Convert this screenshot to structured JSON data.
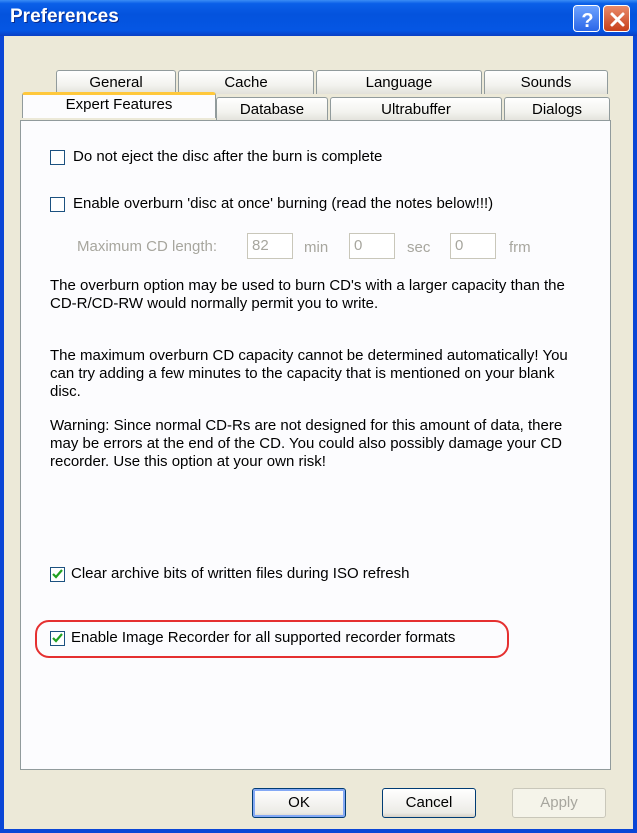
{
  "window": {
    "title": "Preferences"
  },
  "tabs": {
    "row_back": [
      "General",
      "Cache",
      "Language",
      "Sounds"
    ],
    "row_front": [
      "Expert Features",
      "Database",
      "Ultrabuffer",
      "Dialogs"
    ],
    "active": "Expert Features"
  },
  "options": {
    "no_eject": {
      "label": "Do not eject the disc after the burn is complete",
      "checked": false
    },
    "overburn": {
      "label": "Enable overburn 'disc at once' burning (read the notes below!!!)",
      "checked": false
    },
    "clear_archive": {
      "label": "Clear archive bits of written files during ISO refresh",
      "checked": true
    },
    "image_recorder": {
      "label": "Enable Image Recorder for all supported recorder formats",
      "checked": true
    }
  },
  "max_length": {
    "label": "Maximum CD length:",
    "min_value": "82",
    "min_unit": "min",
    "sec_value": "0",
    "sec_unit": "sec",
    "frm_value": "0",
    "frm_unit": "frm"
  },
  "notes": {
    "p1": "The overburn option may be used to burn CD's with a larger capacity than the CD-R/CD-RW would normally permit you to write.",
    "p2": "The maximum overburn CD capacity cannot be determined automatically! You can try adding a few minutes to the capacity that is mentioned on your blank disc.",
    "p3": "Warning: Since normal CD-Rs are not designed for this amount of data, there may be errors at the end of the CD. You could also possibly damage your CD recorder. Use this option at your own risk!"
  },
  "buttons": {
    "ok": "OK",
    "cancel": "Cancel",
    "apply": "Apply"
  },
  "colors": {
    "titlebar": "#0453dd",
    "highlight": "#e53030",
    "tab_accent": "#ffc83c"
  }
}
